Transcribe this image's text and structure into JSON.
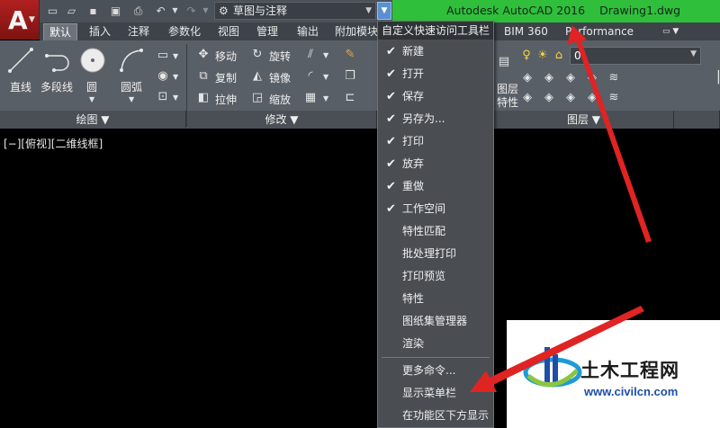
{
  "quick_access": {
    "app_button_letter": "A",
    "icons": [
      "new-icon",
      "open-icon",
      "save-icon",
      "save-as-icon",
      "print-icon",
      "undo-icon",
      "redo-icon"
    ],
    "workspace": "草图与注释",
    "dropdown_arrow": "▼"
  },
  "title": {
    "app": "Autodesk AutoCAD 2016",
    "document": "Drawing1.dwg"
  },
  "ribbon_tabs": [
    {
      "label": "默认",
      "active": true
    },
    {
      "label": "插入"
    },
    {
      "label": "注释"
    },
    {
      "label": "参数化"
    },
    {
      "label": "视图"
    },
    {
      "label": "管理"
    },
    {
      "label": "输出"
    },
    {
      "label": "附加模块"
    },
    {
      "label": "BIM 360"
    },
    {
      "label": "Performance"
    }
  ],
  "draw_panel": {
    "tools": [
      "直线",
      "多段线",
      "圆",
      "圆弧"
    ],
    "footer": "绘图 ▼"
  },
  "modify_panel": {
    "tools": [
      "移动",
      "旋转",
      "复制",
      "镜像",
      "拉伸",
      "缩放"
    ],
    "footer": "修改 ▼"
  },
  "layer_panel": {
    "tools": [
      "图层",
      "特性"
    ],
    "footer": "图层 ▼",
    "combo_value": "0"
  },
  "viewport": {
    "label": "[−][俯视][二维线框]"
  },
  "qa_menu": {
    "header": "自定义快速访问工具栏",
    "items": [
      {
        "label": "新建",
        "checked": true
      },
      {
        "label": "打开",
        "checked": true
      },
      {
        "label": "保存",
        "checked": true
      },
      {
        "label": "另存为...",
        "checked": true
      },
      {
        "label": "打印",
        "checked": true
      },
      {
        "label": "放弃",
        "checked": true
      },
      {
        "label": "重做",
        "checked": true
      },
      {
        "label": "工作空间",
        "checked": true
      },
      {
        "label": "特性匹配",
        "checked": false
      },
      {
        "label": "批处理打印",
        "checked": false
      },
      {
        "label": "打印预览",
        "checked": false
      },
      {
        "label": "特性",
        "checked": false
      },
      {
        "label": "图纸集管理器",
        "checked": false
      },
      {
        "label": "渲染",
        "checked": false
      }
    ],
    "extra_items": [
      "更多命令...",
      "显示菜单栏",
      "在功能区下方显示"
    ]
  },
  "watermark": {
    "name": "土木工程网",
    "url": "www.civilcn.com"
  },
  "colors": {
    "accent_green": "#2fbf3b",
    "arrow_red": "#e02323",
    "app_red": "#b0201f"
  }
}
